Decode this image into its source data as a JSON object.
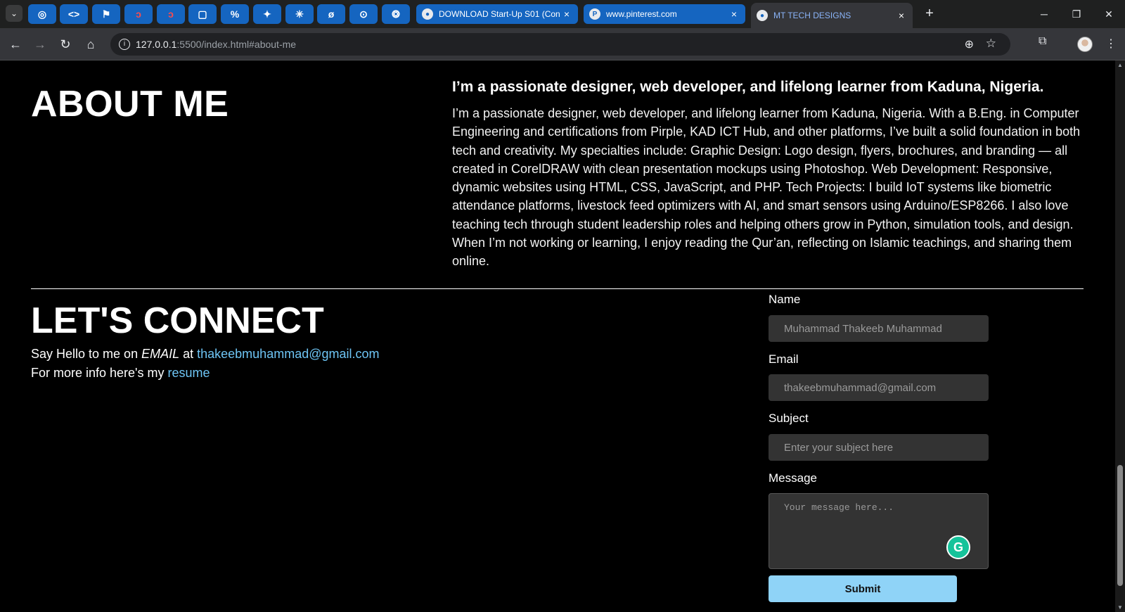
{
  "browser": {
    "tab_dropdown_icon": "chevron-down-icon",
    "pinned_tabs": [
      {
        "icon": "circle-logo-icon",
        "glyph": "◎"
      },
      {
        "icon": "code-brackets-icon",
        "glyph": "<>"
      },
      {
        "icon": "flag-icon",
        "glyph": "⚑"
      },
      {
        "icon": "red-swirl-icon",
        "glyph": "ↄ"
      },
      {
        "icon": "red-swirl-icon",
        "glyph": "ↄ"
      },
      {
        "icon": "white-square-icon",
        "glyph": "▢"
      },
      {
        "icon": "zbrush-icon",
        "glyph": "%"
      },
      {
        "icon": "sparkle-icon",
        "glyph": "✦"
      },
      {
        "icon": "starburst-icon",
        "glyph": "✳"
      },
      {
        "icon": "slashed-circle-icon",
        "glyph": "ø"
      },
      {
        "icon": "github-icon",
        "glyph": "⊙"
      },
      {
        "icon": "openai-icon",
        "glyph": "❂"
      }
    ],
    "tabs": [
      {
        "title": "DOWNLOAD Start-Up S01 (Con",
        "close": "×"
      },
      {
        "title": "www.pinterest.com",
        "close": "×"
      },
      {
        "title": "MT TECH DESIGNS",
        "close": "×"
      }
    ],
    "new_tab_label": "+",
    "window_controls": {
      "minimize": "─",
      "maximize": "❐",
      "close": "✕"
    },
    "nav": {
      "back": "←",
      "forward": "→",
      "reload": "↻",
      "home": "⌂"
    },
    "url_host": "127.0.0.1",
    "url_rest": ":5500/index.html#about-me",
    "omnibox_icons": {
      "info": "i",
      "zoom": "⊕",
      "star": "☆"
    },
    "extensions_glyph": "⧉",
    "menu_glyph": "⋮"
  },
  "about": {
    "heading": "ABOUT ME",
    "lead": "I’m a passionate designer, web developer, and lifelong learner from Kaduna, Nigeria.",
    "body": "I’m a passionate designer, web developer, and lifelong learner from Kaduna, Nigeria. With a B.Eng. in Computer Engineering and certifications from Pirple, KAD ICT Hub, and other platforms, I’ve built a solid foundation in both tech and creativity. My specialties include: Graphic Design: Logo design, flyers, brochures, and branding — all created in CorelDRAW with clean presentation mockups using Photoshop. Web Development: Responsive, dynamic websites using HTML, CSS, JavaScript, and PHP. Tech Projects: I build IoT systems like biometric attendance platforms, livestock feed optimizers with AI, and smart sensors using Arduino/ESP8266. I also love teaching tech through student leadership roles and helping others grow in Python, simulation tools, and design. When I’m not working or learning, I enjoy reading the Qur’an, reflecting on Islamic teachings, and sharing them online."
  },
  "connect": {
    "heading": "LET'S CONNECT",
    "hello_prefix": "Say Hello to me on ",
    "hello_medium": "EMAIL",
    "hello_mid": " at ",
    "email_link": "thakeebmuhammad@gmail.com",
    "info_prefix": "For more info here's my ",
    "resume_link": "resume"
  },
  "form": {
    "name_label": "Name",
    "name_placeholder": "Muhammad Thakeeb Muhammad",
    "email_label": "Email",
    "email_placeholder": "thakeebmuhammad@gmail.com",
    "subject_label": "Subject",
    "subject_placeholder": "Enter your subject here",
    "message_label": "Message",
    "message_placeholder": "Your message here...",
    "grammarly_glyph": "G",
    "submit_label": "Submit"
  },
  "scrollbar": {
    "up": "▲",
    "down": "▼"
  },
  "colors": {
    "background": "#000000",
    "link": "#6ec5f5",
    "submit": "#8fd3f7",
    "input": "#333333",
    "tab_blue": "#1565c0"
  }
}
